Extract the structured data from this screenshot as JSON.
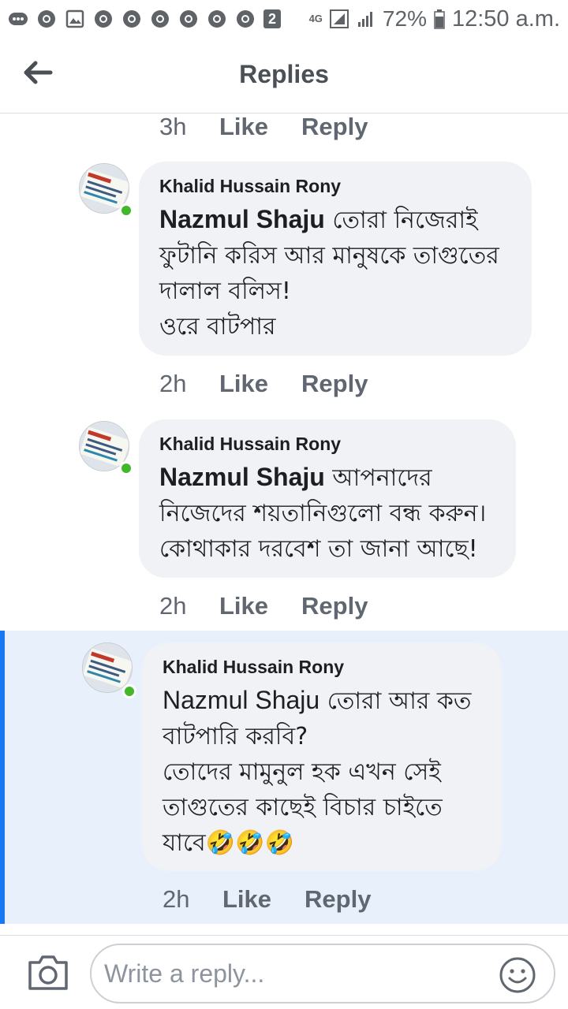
{
  "status_bar": {
    "network": "4G",
    "battery": "72%",
    "time": "12:50 a.m.",
    "sim_badge": "2"
  },
  "header": {
    "title": "Replies",
    "back_icon": "arrow-left-icon"
  },
  "top_actions": {
    "time": "3h",
    "like": "Like",
    "reply": "Reply"
  },
  "comments": [
    {
      "author": "Khalid Hussain Rony",
      "mention": "Nazmul Shaju",
      "text": " তোরা নিজেরাই\nফুটানি করিস আর মানুষকে তাগুতের\nদালাল বলিস!\nওরে বাটপার",
      "time": "2h",
      "like": "Like",
      "reply": "Reply"
    },
    {
      "author": "Khalid Hussain Rony",
      "mention": "Nazmul Shaju",
      "text": " আপনাদের\nনিজেদের শয়তানিগুলো বন্ধ করুন।\nকোথাকার দরবেশ তা জানা আছে!",
      "time": "2h",
      "like": "Like",
      "reply": "Reply"
    },
    {
      "author": "Khalid Hussain Rony",
      "mention": "Nazmul Shaju",
      "text": " তোরা আর কত\nবাটপারি করবি?\nতোদের মামুনুল হক এখন সেই\nতাগুতের কাছেই বিচার চাইতে\nযাবে🤣🤣🤣",
      "time": "2h",
      "like": "Like",
      "reply": "Reply"
    }
  ],
  "composer": {
    "placeholder": "Write a reply...",
    "camera_icon": "camera-icon",
    "emoji_icon": "smiley-icon"
  },
  "colors": {
    "accent": "#1877f2",
    "highlight_bg": "#e7f0fb",
    "bubble_bg": "#f0f2f5",
    "online": "#42b72a"
  }
}
